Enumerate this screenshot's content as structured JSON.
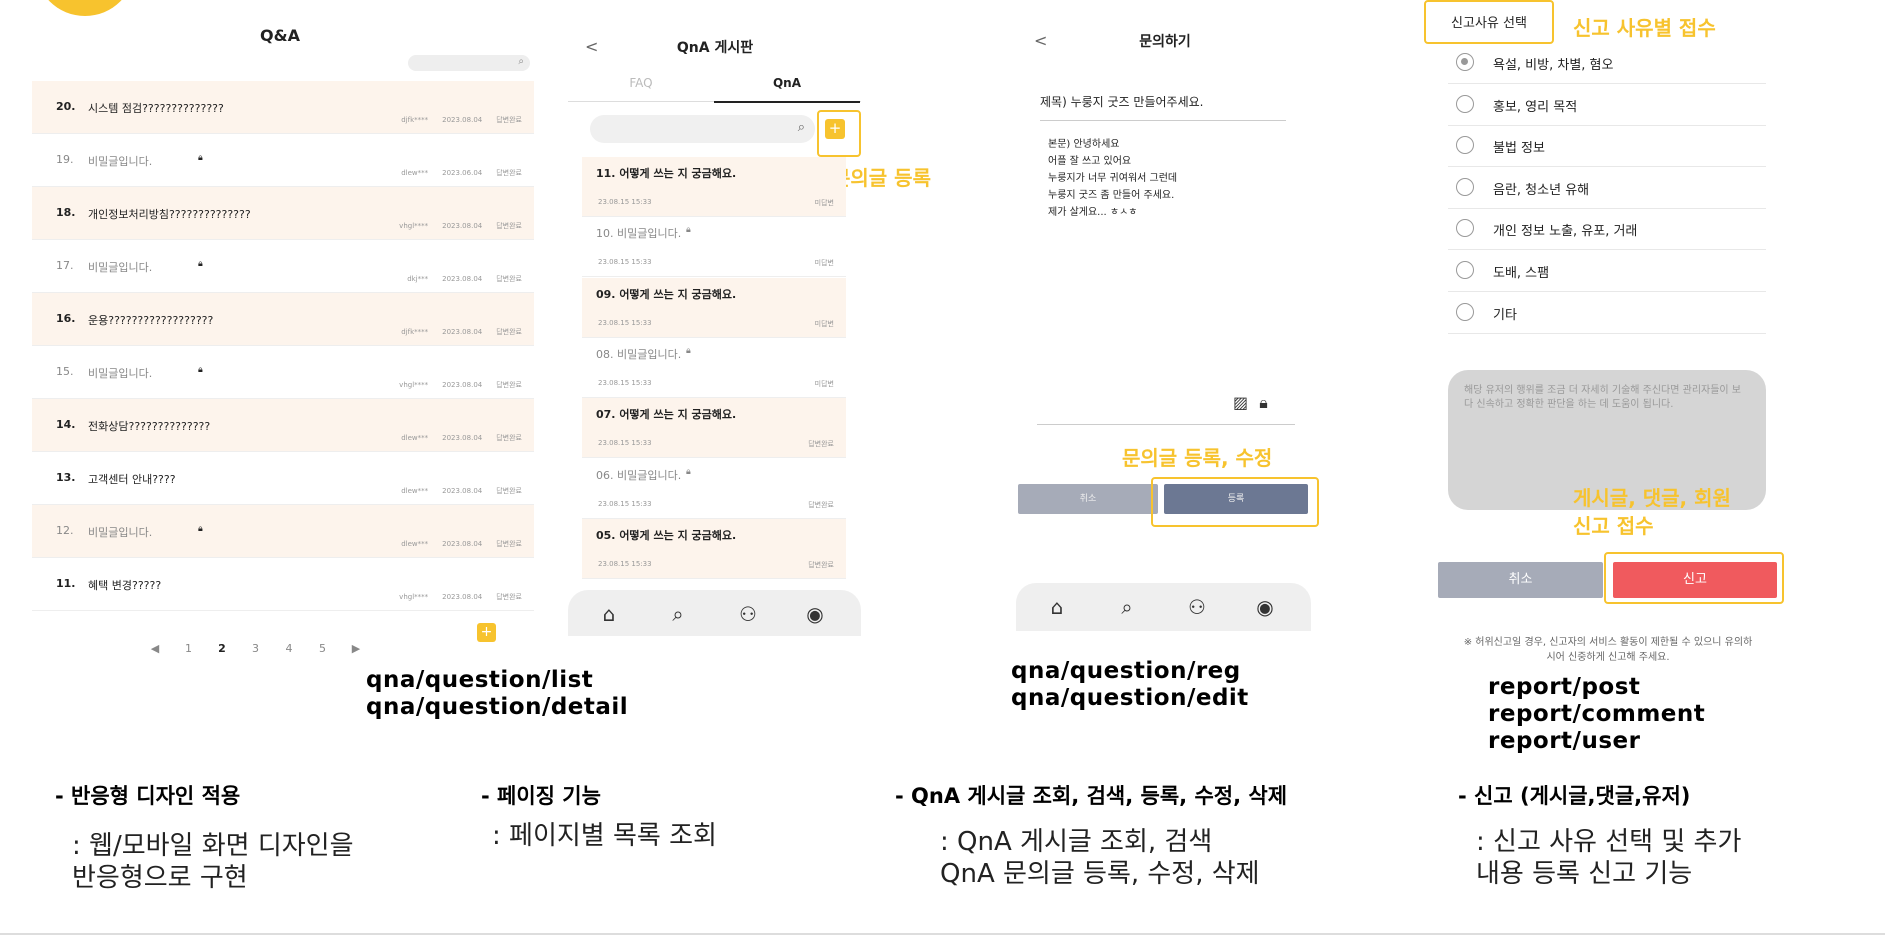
{
  "panel1": {
    "title": "Q&A",
    "rows": [
      {
        "num": "20.",
        "title": "시스템 점검??????????????",
        "secret": false,
        "user": "djfk****",
        "date": "2023.08.04",
        "status": "답변완료"
      },
      {
        "num": "19.",
        "title": "비밀글입니다.",
        "secret": true,
        "user": "dlew***",
        "date": "2023.06.04",
        "status": "답변완료"
      },
      {
        "num": "18.",
        "title": "개인정보처리방침??????????????",
        "secret": false,
        "user": "vhgl****",
        "date": "2023.08.04",
        "status": "답변완료"
      },
      {
        "num": "17.",
        "title": "비밀글입니다.",
        "secret": true,
        "user": "dkj***",
        "date": "2023.08.04",
        "status": "답변완료"
      },
      {
        "num": "16.",
        "title": "운용??????????????????",
        "secret": false,
        "user": "djfk****",
        "date": "2023.08.04",
        "status": "답변완료"
      },
      {
        "num": "15.",
        "title": "비밀글입니다.",
        "secret": true,
        "user": "vhgl****",
        "date": "2023.08.04",
        "status": "답변완료"
      },
      {
        "num": "14.",
        "title": "전화상담??????????????",
        "secret": false,
        "user": "dlew***",
        "date": "2023.08.04",
        "status": "답변완료"
      },
      {
        "num": "13.",
        "title": "고객센터 안내????",
        "secret": false,
        "user": "dlew***",
        "date": "2023.08.04",
        "status": "답변완료"
      },
      {
        "num": "12.",
        "title": "비밀글입니다.",
        "secret": true,
        "user": "dlew***",
        "date": "2023.08.04",
        "status": "답변완료"
      },
      {
        "num": "11.",
        "title": "혜택 변경?????",
        "secret": false,
        "user": "vhgl****",
        "date": "2023.08.04",
        "status": "답변완료"
      }
    ],
    "pager": {
      "prev": "◀",
      "pages": [
        "1",
        "2",
        "3",
        "4",
        "5"
      ],
      "current": "2",
      "next": "▶"
    },
    "add_label": "+"
  },
  "panel2": {
    "back": "<",
    "title": "QnA 게시판",
    "tabs": [
      "FAQ",
      "QnA"
    ],
    "add_label": "+",
    "annotation": "문의글 등록",
    "rows": [
      {
        "title": "11.   어떻게 쓰는 지 궁금해요.",
        "secret": false,
        "date": "23.08.15 15:33",
        "status": "미답변"
      },
      {
        "title": "10.  비밀글입니다.",
        "secret": true,
        "date": "23.08.15 15:33",
        "status": "미답변"
      },
      {
        "title": "09.   어떻게 쓰는 지 궁금해요.",
        "secret": false,
        "date": "23.08.15 15:33",
        "status": "미답변"
      },
      {
        "title": "08.  비밀글입니다.",
        "secret": true,
        "date": "23.08.15 15:33",
        "status": "미답변"
      },
      {
        "title": "07.   어떻게 쓰는 지 궁금해요.",
        "secret": false,
        "date": "23.08.15 15:33",
        "status": "답변완료"
      },
      {
        "title": "06.  비밀글입니다.",
        "secret": true,
        "date": "23.08.15 15:33",
        "status": "답변완료"
      },
      {
        "title": "05.   어떻게 쓰는 지 궁금해요.",
        "secret": false,
        "date": "23.08.15 15:33",
        "status": "답변완료"
      }
    ]
  },
  "panel3": {
    "back": "<",
    "title": "문의하기",
    "subject": "제목) 누룽지 굿즈 만들어주세요.",
    "body": [
      "본문) 안녕하세요",
      "어플 잘 쓰고 있어요",
      "누룽지가 너무 귀여워서 그런데",
      "누룽지 굿즈 좀 만들어 주세요.",
      "제가 살게요... ㅎㅅㅎ"
    ],
    "annotation": "문의글 등록, 수정",
    "cancel_label": "취소",
    "submit_label": "등록"
  },
  "panel4": {
    "reason_title": "신고사유 선택",
    "annotation_top": "신고 사유별 접수",
    "reasons": [
      "욕설, 비방, 차별, 혐오",
      "홍보, 영리 목적",
      "불법 정보",
      "음란, 청소년 유해",
      "개인 정보 노출, 유포, 거래",
      "도배, 스팸",
      "기타"
    ],
    "selected_reason": "욕설, 비방, 차별, 혐오",
    "textarea_placeholder": "해당 유저의 행위를 조금 더 자세히 기술해 주신다면 관리자들이 보다 신속하고 정확한 판단을 하는 데 도움이 됩니다.",
    "annotation_bottom_1": "게시글, 댓글, 회원",
    "annotation_bottom_2": "신고 접수",
    "cancel_label": "취소",
    "report_label": "신고",
    "note": "※ 허위신고일 경우, 신고자의 서비스 활동이 제한될 수 있으니 유의하시어 신중하게 신고해 주세요."
  },
  "routes": {
    "qna_list": "qna/question/list",
    "qna_detail": "qna/question/detail",
    "qna_reg": "qna/question/reg",
    "qna_edit": "qna/question/edit",
    "report_post": "report/post",
    "report_comment": "report/comment",
    "report_user": "report/user"
  },
  "features": [
    {
      "heading": "- 반응형 디자인 적용",
      "desc_1": ": 웹/모바일 화면 디자인을",
      "desc_2": "반응형으로 구현"
    },
    {
      "heading": "- 페이징 기능",
      "desc_1": ": 페이지별 목록 조회",
      "desc_2": ""
    },
    {
      "heading": "- QnA 게시글 조회, 검색, 등록, 수정, 삭제",
      "desc_1": ": QnA 게시글 조회, 검색",
      "desc_2": "QnA 문의글 등록, 수정, 삭제"
    },
    {
      "heading": "- 신고 (게시글,댓글,유저)",
      "desc_1": ": 신고 사유 선택 및 추가",
      "desc_2": "내용 등록 신고 기능"
    }
  ],
  "colors": {
    "accent": "#f7c32e",
    "report_red": "#f05a5e",
    "submit_navy": "#6c7893",
    "cancel_gray": "#a6abb8",
    "row_tint": "#fdf4ec"
  },
  "icons": [
    "search-icon",
    "plus-icon",
    "lock-icon",
    "home-icon",
    "people-icon",
    "profile-icon",
    "image-icon",
    "back-icon"
  ]
}
